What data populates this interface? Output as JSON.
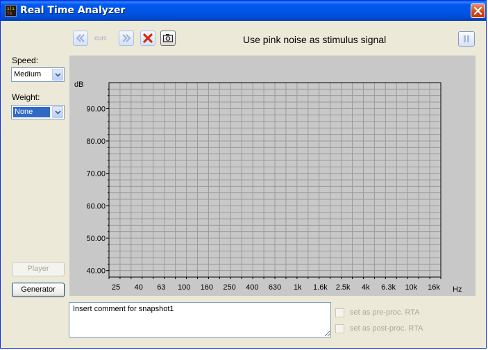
{
  "window": {
    "title": "Real Time Analyzer"
  },
  "toolbar": {
    "prev_icon": "double-chevron-left-icon",
    "curr_label": "curr.",
    "next_icon": "double-chevron-right-icon",
    "delete_icon": "red-x-icon",
    "camera_icon": "camera-icon",
    "hint": "Use pink noise as stimulus signal",
    "pause_icon": "pause-icon"
  },
  "sidebar": {
    "speed_label": "Speed:",
    "speed_value": "Medium",
    "weight_label": "Weight:",
    "weight_value": "None",
    "player_button": "Player",
    "generator_button": "Generator"
  },
  "chart_data": {
    "type": "line",
    "ylabel": "dB",
    "xlabel": "Hz",
    "y_ticks": [
      "40.00",
      "50.00",
      "60.00",
      "70.00",
      "80.00",
      "90.00"
    ],
    "ylim": [
      38,
      98
    ],
    "x_ticks": [
      "25",
      "40",
      "63",
      "100",
      "160",
      "250",
      "400",
      "630",
      "1k",
      "1.6k",
      "2.5k",
      "4k",
      "6.3k",
      "10k",
      "16k"
    ],
    "grid": true,
    "series": []
  },
  "comment": {
    "value": "Insert comment for snapshot1"
  },
  "options": {
    "pre_proc_label": "set as pre-proc. RTA",
    "post_proc_label": "set as post-proc. RTA",
    "pre_proc_checked": false,
    "post_proc_checked": false
  },
  "colors": {
    "titlebar": "#0054e3",
    "window_bg": "#ece9d8",
    "plot_bg": "#c8c8c8",
    "grid": "#9a9a9a"
  }
}
